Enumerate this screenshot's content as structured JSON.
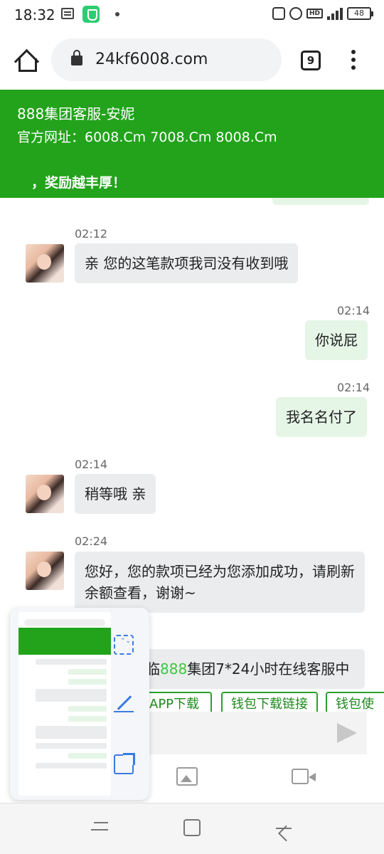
{
  "status_bar": {
    "time": "18:32",
    "battery": "48",
    "hd_label": "HD",
    "network": "5G"
  },
  "browser": {
    "url": "24kf6008.com",
    "tab_count": "9"
  },
  "header": {
    "title": "888集团客服-安妮",
    "subtitle": "官方网址：6008.Cm 7008.Cm 8008.Cm",
    "marquee": "，奖励越丰厚！",
    "color": "#22a31b"
  },
  "messages": [
    {
      "side": "in",
      "time": "02:12",
      "text": "亲 您的这笔款项我司没有收到哦"
    },
    {
      "side": "out",
      "time": "02:14",
      "text": "你说屁"
    },
    {
      "side": "out",
      "time": "02:14",
      "text": "我名名付了"
    },
    {
      "side": "in",
      "time": "02:14",
      "text": "稍等哦 亲"
    },
    {
      "side": "in",
      "time": "02:24",
      "text": "您好，您的款项已经为您添加成功，请刷新余额查看，谢谢~"
    }
  ],
  "welcome": {
    "prefix": "临",
    "number": "888",
    "suffix": "集团7*24小时在线客服中"
  },
  "quick_buttons": [
    "APP下载",
    "钱包下载链接",
    "钱包使"
  ],
  "toolbar": {
    "image_icon": "image-icon",
    "video_icon": "video-icon"
  },
  "colors": {
    "in_bubble": "#ebecee",
    "out_bubble": "#e5f5e6",
    "quick_button_border": "#2aa02a",
    "screenshot_accent": "#3a7be0"
  }
}
